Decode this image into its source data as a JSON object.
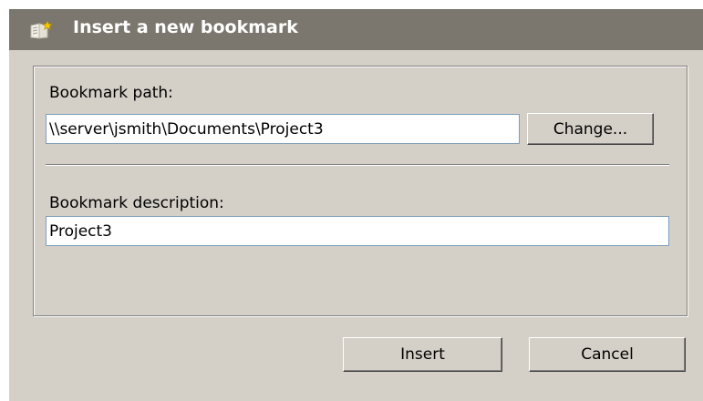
{
  "dialog": {
    "title": "Insert a new bookmark",
    "icon": "bookmark-add-icon"
  },
  "bookmark_path": {
    "label": "Bookmark path:",
    "value": "\\\\server\\jsmith\\Documents\\Project3",
    "change_label": "Change..."
  },
  "bookmark_description": {
    "label": "Bookmark description:",
    "value": "Project3"
  },
  "buttons": {
    "insert_label": "Insert",
    "cancel_label": "Cancel"
  },
  "colors": {
    "title_bar": "#7b776e",
    "dialog_face": "#d4d0c8",
    "title_text": "#ffffff"
  }
}
